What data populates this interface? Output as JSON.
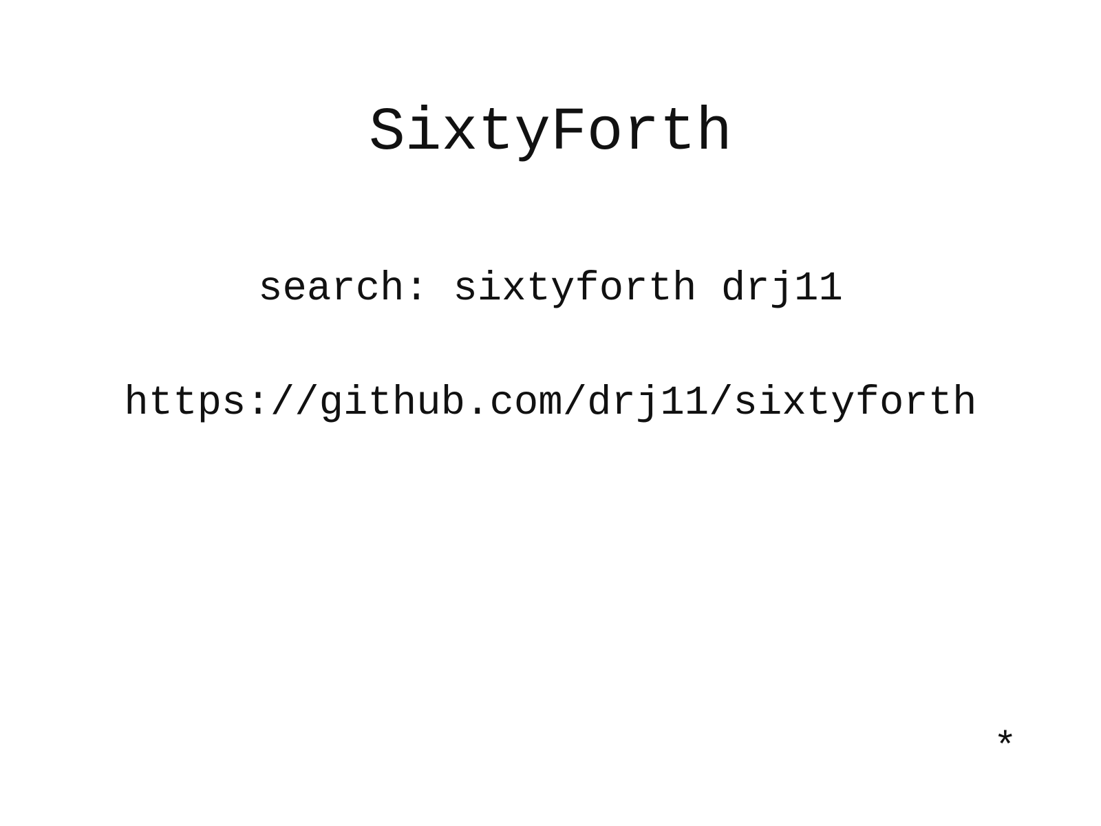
{
  "slide": {
    "title": "SixtyForth",
    "search_line": "search: sixtyforth drj11",
    "url": "https://github.com/drj11/sixtyforth",
    "marker": "*"
  }
}
